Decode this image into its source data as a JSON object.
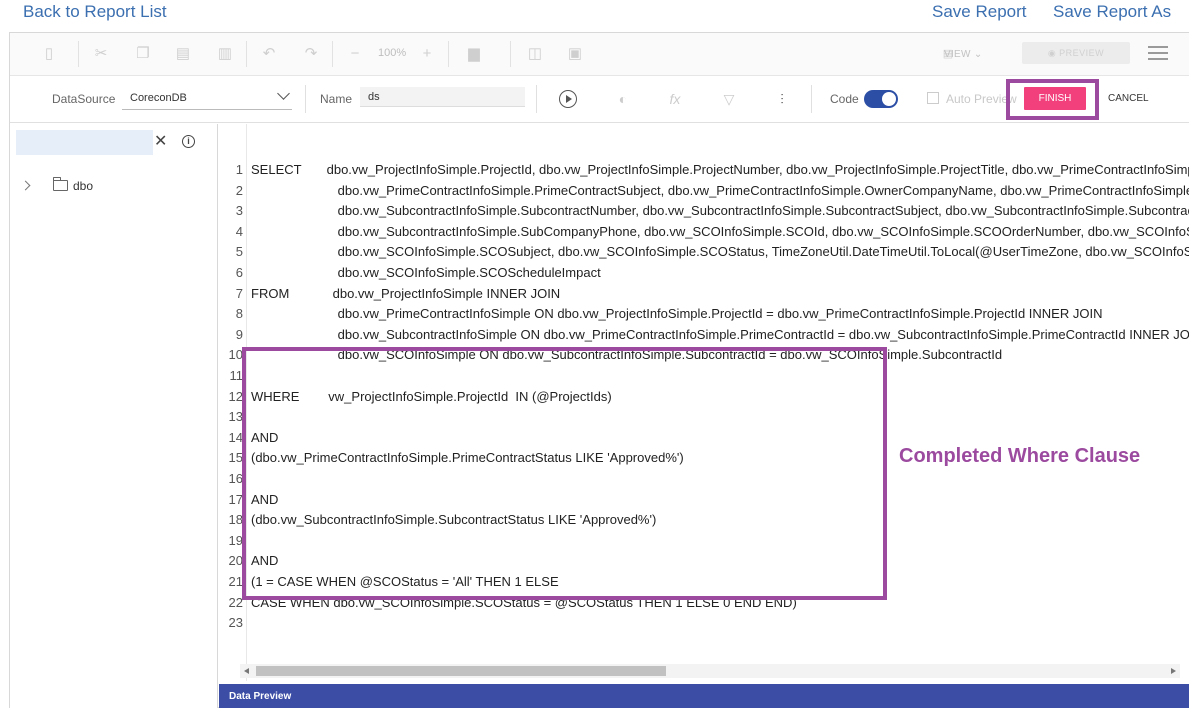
{
  "nav": {
    "back": "Back to Report List",
    "save": "Save Report",
    "save_as": "Save Report As"
  },
  "toolbar": {
    "zoom": "100%",
    "view": "VIEW",
    "preview": "PREVIEW"
  },
  "query_bar": {
    "datasource_label": "DataSource",
    "datasource_value": "CoreconDB",
    "name_label": "Name",
    "name_value": "ds",
    "code_label": "Code",
    "code_enabled": true,
    "auto_preview_label": "Auto Preview",
    "finish": "FINISH",
    "cancel": "CANCEL",
    "accent_color": "#f2407d"
  },
  "tree": {
    "search_value": "",
    "items": [
      {
        "label": "dbo"
      }
    ]
  },
  "editor": {
    "lines": [
      {
        "n": "1",
        "text": "SELECT       dbo.vw_ProjectInfoSimple.ProjectId, dbo.vw_ProjectInfoSimple.ProjectNumber, dbo.vw_ProjectInfoSimple.ProjectTitle, dbo.vw_PrimeContractInfoSimple.PrimeContractId,"
      },
      {
        "n": "2",
        "text": "                        dbo.vw_PrimeContractInfoSimple.PrimeContractSubject, dbo.vw_PrimeContractInfoSimple.OwnerCompanyName, dbo.vw_PrimeContractInfoSimple.PrimeContractStatus,"
      },
      {
        "n": "3",
        "text": "                        dbo.vw_SubcontractInfoSimple.SubcontractNumber, dbo.vw_SubcontractInfoSimple.SubcontractSubject, dbo.vw_SubcontractInfoSimple.SubcontractStatus,"
      },
      {
        "n": "4",
        "text": "                        dbo.vw_SubcontractInfoSimple.SubCompanyPhone, dbo.vw_SCOInfoSimple.SCOId, dbo.vw_SCOInfoSimple.SCOOrderNumber, dbo.vw_SCOInfoSimple.SCODate,"
      },
      {
        "n": "5",
        "text": "                        dbo.vw_SCOInfoSimple.SCOSubject, dbo.vw_SCOInfoSimple.SCOStatus, TimeZoneUtil.DateTimeUtil.ToLocal(@UserTimeZone, dbo.vw_SCOInfoSimple.SCODate),"
      },
      {
        "n": "6",
        "text": "                        dbo.vw_SCOInfoSimple.SCOScheduleImpact"
      },
      {
        "n": "7",
        "text": "FROM            dbo.vw_ProjectInfoSimple INNER JOIN"
      },
      {
        "n": "8",
        "text": "                        dbo.vw_PrimeContractInfoSimple ON dbo.vw_ProjectInfoSimple.ProjectId = dbo.vw_PrimeContractInfoSimple.ProjectId INNER JOIN"
      },
      {
        "n": "9",
        "text": "                        dbo.vw_SubcontractInfoSimple ON dbo.vw_PrimeContractInfoSimple.PrimeContractId = dbo.vw_SubcontractInfoSimple.PrimeContractId INNER JOIN"
      },
      {
        "n": "10",
        "text": "                        dbo.vw_SCOInfoSimple ON dbo.vw_SubcontractInfoSimple.SubcontractId = dbo.vw_SCOInfoSimple.SubcontractId"
      },
      {
        "n": "11",
        "text": ""
      },
      {
        "n": "12",
        "text": "WHERE        vw_ProjectInfoSimple.ProjectId  IN (@ProjectIds)"
      },
      {
        "n": "13",
        "text": ""
      },
      {
        "n": "14",
        "text": "AND"
      },
      {
        "n": "15",
        "text": "(dbo.vw_PrimeContractInfoSimple.PrimeContractStatus LIKE 'Approved%')"
      },
      {
        "n": "16",
        "text": ""
      },
      {
        "n": "17",
        "text": "AND"
      },
      {
        "n": "18",
        "text": "(dbo.vw_SubcontractInfoSimple.SubcontractStatus LIKE 'Approved%')"
      },
      {
        "n": "19",
        "text": ""
      },
      {
        "n": "20",
        "text": "AND"
      },
      {
        "n": "21",
        "text": "(1 = CASE WHEN @SCOStatus = 'All' THEN 1 ELSE"
      },
      {
        "n": "22",
        "text": "CASE WHEN dbo.vw_SCOInfoSimple.SCOStatus = @SCOStatus THEN 1 ELSE 0 END END)"
      },
      {
        "n": "23",
        "text": ""
      }
    ]
  },
  "annotation": {
    "text": "Completed Where Clause",
    "color": "#9b4a9f"
  },
  "data_preview": {
    "label": "Data Preview"
  }
}
